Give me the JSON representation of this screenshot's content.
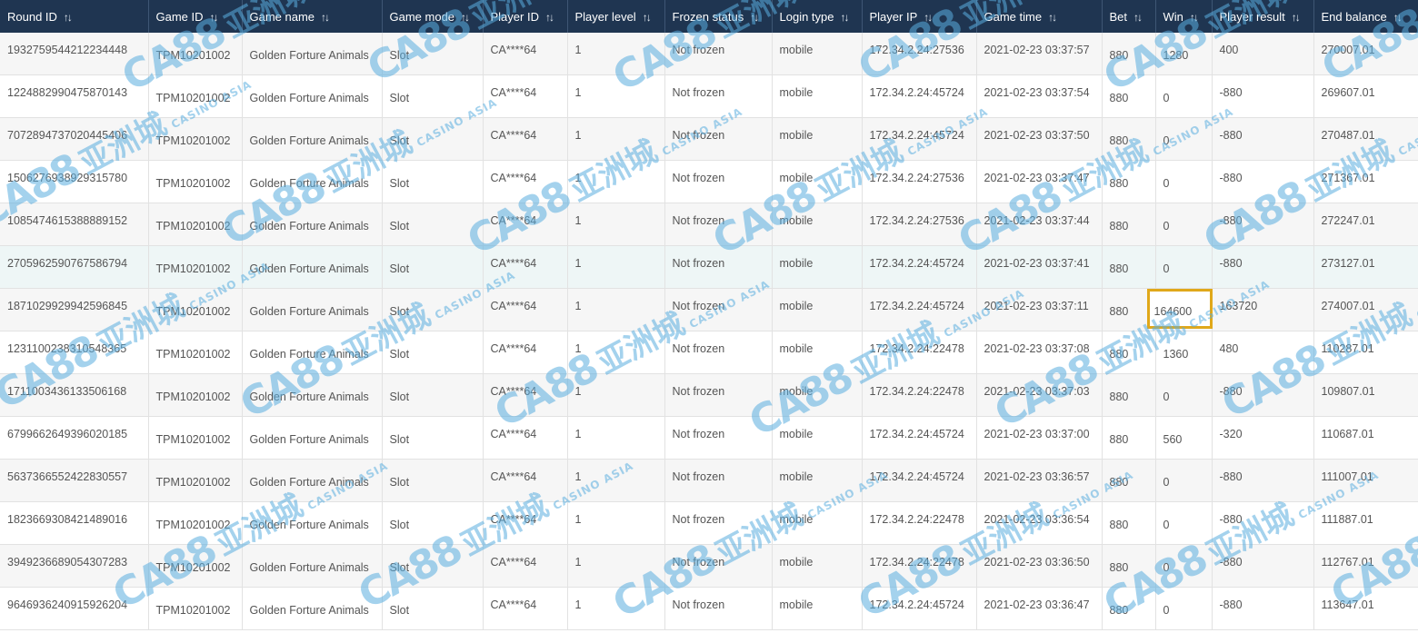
{
  "columns": [
    {
      "label": "Round ID",
      "sort_icon": "sort-arrows-icon"
    },
    {
      "label": "Game ID",
      "sort_icon": "sort-arrows-icon"
    },
    {
      "label": "Game name",
      "sort_icon": "sort-arrows-icon"
    },
    {
      "label": "Game mode",
      "sort_icon": "sort-arrows-icon"
    },
    {
      "label": "Player ID",
      "sort_icon": "sort-arrows-icon"
    },
    {
      "label": "Player level",
      "sort_icon": "sort-arrows-icon"
    },
    {
      "label": "Frozen status",
      "sort_icon": "sort-arrows-icon"
    },
    {
      "label": "Login type",
      "sort_icon": "sort-arrows-icon"
    },
    {
      "label": "Player IP",
      "sort_icon": "sort-arrows-icon"
    },
    {
      "label": "Game time",
      "sort_icon": "sort-arrows-icon"
    },
    {
      "label": "Bet",
      "sort_icon": "sort-arrows-icon"
    },
    {
      "label": "Win",
      "sort_icon": "sort-arrows-icon"
    },
    {
      "label": "Player result",
      "sort_icon": "sort-arrows-icon"
    },
    {
      "label": "End balance",
      "sort_icon": "sort-arrows-icon"
    }
  ],
  "rows": [
    {
      "round_id": "1932759544212234448",
      "game_id": "TPM10201002",
      "game_name": "Golden Forture Animals",
      "game_mode": "Slot",
      "player_id": "CA****64",
      "player_level": "1",
      "frozen_status": "Not frozen",
      "login_type": "mobile",
      "player_ip": "172.34.2.24:27536",
      "game_time": "2021-02-23 03:37:57",
      "bet": "880",
      "win": "1280",
      "player_result": "400",
      "end_balance": "270007.01"
    },
    {
      "round_id": "1224882990475870143",
      "game_id": "TPM10201002",
      "game_name": "Golden Forture Animals",
      "game_mode": "Slot",
      "player_id": "CA****64",
      "player_level": "1",
      "frozen_status": "Not frozen",
      "login_type": "mobile",
      "player_ip": "172.34.2.24:45724",
      "game_time": "2021-02-23 03:37:54",
      "bet": "880",
      "win": "0",
      "player_result": "-880",
      "end_balance": "269607.01"
    },
    {
      "round_id": "7072894737020445406",
      "game_id": "TPM10201002",
      "game_name": "Golden Forture Animals",
      "game_mode": "Slot",
      "player_id": "CA****64",
      "player_level": "1",
      "frozen_status": "Not frozen",
      "login_type": "mobile",
      "player_ip": "172.34.2.24:45724",
      "game_time": "2021-02-23 03:37:50",
      "bet": "880",
      "win": "0",
      "player_result": "-880",
      "end_balance": "270487.01"
    },
    {
      "round_id": "1506276938929315780",
      "game_id": "TPM10201002",
      "game_name": "Golden Forture Animals",
      "game_mode": "Slot",
      "player_id": "CA****64",
      "player_level": "1",
      "frozen_status": "Not frozen",
      "login_type": "mobile",
      "player_ip": "172.34.2.24:27536",
      "game_time": "2021-02-23 03:37:47",
      "bet": "880",
      "win": "0",
      "player_result": "-880",
      "end_balance": "271367.01"
    },
    {
      "round_id": "1085474615388889152",
      "game_id": "TPM10201002",
      "game_name": "Golden Forture Animals",
      "game_mode": "Slot",
      "player_id": "CA****64",
      "player_level": "1",
      "frozen_status": "Not frozen",
      "login_type": "mobile",
      "player_ip": "172.34.2.24:27536",
      "game_time": "2021-02-23 03:37:44",
      "bet": "880",
      "win": "0",
      "player_result": "-880",
      "end_balance": "272247.01"
    },
    {
      "round_id": "2705962590767586794",
      "game_id": "TPM10201002",
      "game_name": "Golden Forture Animals",
      "game_mode": "Slot",
      "player_id": "CA****64",
      "player_level": "1",
      "frozen_status": "Not frozen",
      "login_type": "mobile",
      "player_ip": "172.34.2.24:45724",
      "game_time": "2021-02-23 03:37:41",
      "bet": "880",
      "win": "0",
      "player_result": "-880",
      "end_balance": "273127.01"
    },
    {
      "round_id": "1871029929942596845",
      "game_id": "TPM10201002",
      "game_name": "Golden Forture Animals",
      "game_mode": "Slot",
      "player_id": "CA****64",
      "player_level": "1",
      "frozen_status": "Not frozen",
      "login_type": "mobile",
      "player_ip": "172.34.2.24:45724",
      "game_time": "2021-02-23 03:37:11",
      "bet": "880",
      "win": "164600",
      "player_result": "163720",
      "end_balance": "274007.01"
    },
    {
      "round_id": "1231100238310548365",
      "game_id": "TPM10201002",
      "game_name": "Golden Forture Animals",
      "game_mode": "Slot",
      "player_id": "CA****64",
      "player_level": "1",
      "frozen_status": "Not frozen",
      "login_type": "mobile",
      "player_ip": "172.34.2.24:22478",
      "game_time": "2021-02-23 03:37:08",
      "bet": "880",
      "win": "1360",
      "player_result": "480",
      "end_balance": "110287.01"
    },
    {
      "round_id": "1711003436133506168",
      "game_id": "TPM10201002",
      "game_name": "Golden Forture Animals",
      "game_mode": "Slot",
      "player_id": "CA****64",
      "player_level": "1",
      "frozen_status": "Not frozen",
      "login_type": "mobile",
      "player_ip": "172.34.2.24:22478",
      "game_time": "2021-02-23 03:37:03",
      "bet": "880",
      "win": "0",
      "player_result": "-880",
      "end_balance": "109807.01"
    },
    {
      "round_id": "6799662649396020185",
      "game_id": "TPM10201002",
      "game_name": "Golden Forture Animals",
      "game_mode": "Slot",
      "player_id": "CA****64",
      "player_level": "1",
      "frozen_status": "Not frozen",
      "login_type": "mobile",
      "player_ip": "172.34.2.24:45724",
      "game_time": "2021-02-23 03:37:00",
      "bet": "880",
      "win": "560",
      "player_result": "-320",
      "end_balance": "110687.01"
    },
    {
      "round_id": "5637366552422830557",
      "game_id": "TPM10201002",
      "game_name": "Golden Forture Animals",
      "game_mode": "Slot",
      "player_id": "CA****64",
      "player_level": "1",
      "frozen_status": "Not frozen",
      "login_type": "mobile",
      "player_ip": "172.34.2.24:45724",
      "game_time": "2021-02-23 03:36:57",
      "bet": "880",
      "win": "0",
      "player_result": "-880",
      "end_balance": "111007.01"
    },
    {
      "round_id": "1823669308421489016",
      "game_id": "TPM10201002",
      "game_name": "Golden Forture Animals",
      "game_mode": "Slot",
      "player_id": "CA****64",
      "player_level": "1",
      "frozen_status": "Not frozen",
      "login_type": "mobile",
      "player_ip": "172.34.2.24:22478",
      "game_time": "2021-02-23 03:36:54",
      "bet": "880",
      "win": "0",
      "player_result": "-880",
      "end_balance": "111887.01"
    },
    {
      "round_id": "3949236689054307283",
      "game_id": "TPM10201002",
      "game_name": "Golden Forture Animals",
      "game_mode": "Slot",
      "player_id": "CA****64",
      "player_level": "1",
      "frozen_status": "Not frozen",
      "login_type": "mobile",
      "player_ip": "172.34.2.24:22478",
      "game_time": "2021-02-23 03:36:50",
      "bet": "880",
      "win": "0",
      "player_result": "-880",
      "end_balance": "112767.01"
    },
    {
      "round_id": "9646936240915926204",
      "game_id": "TPM10201002",
      "game_name": "Golden Forture Animals",
      "game_mode": "Slot",
      "player_id": "CA****64",
      "player_level": "1",
      "frozen_status": "Not frozen",
      "login_type": "mobile",
      "player_ip": "172.34.2.24:45724",
      "game_time": "2021-02-23 03:36:47",
      "bet": "880",
      "win": "0",
      "player_result": "-880",
      "end_balance": "113647.01"
    }
  ],
  "highlighted_cell": {
    "row_index": 6,
    "column": "win",
    "color": "#e0a81a"
  },
  "hover_row_index": 5,
  "watermark": {
    "logo_text": "CA88",
    "chinese_text": "亚洲城",
    "sub_text": "CASINO ASIA",
    "color": "#5aaee0"
  },
  "colors": {
    "header_bg": "#1f3551",
    "header_text": "#ffffff",
    "row_even": "#f6f6f6",
    "row_odd": "#ffffff",
    "row_hover": "#eef6f6",
    "cell_text": "#555555",
    "highlight_border": "#e0a81a"
  }
}
